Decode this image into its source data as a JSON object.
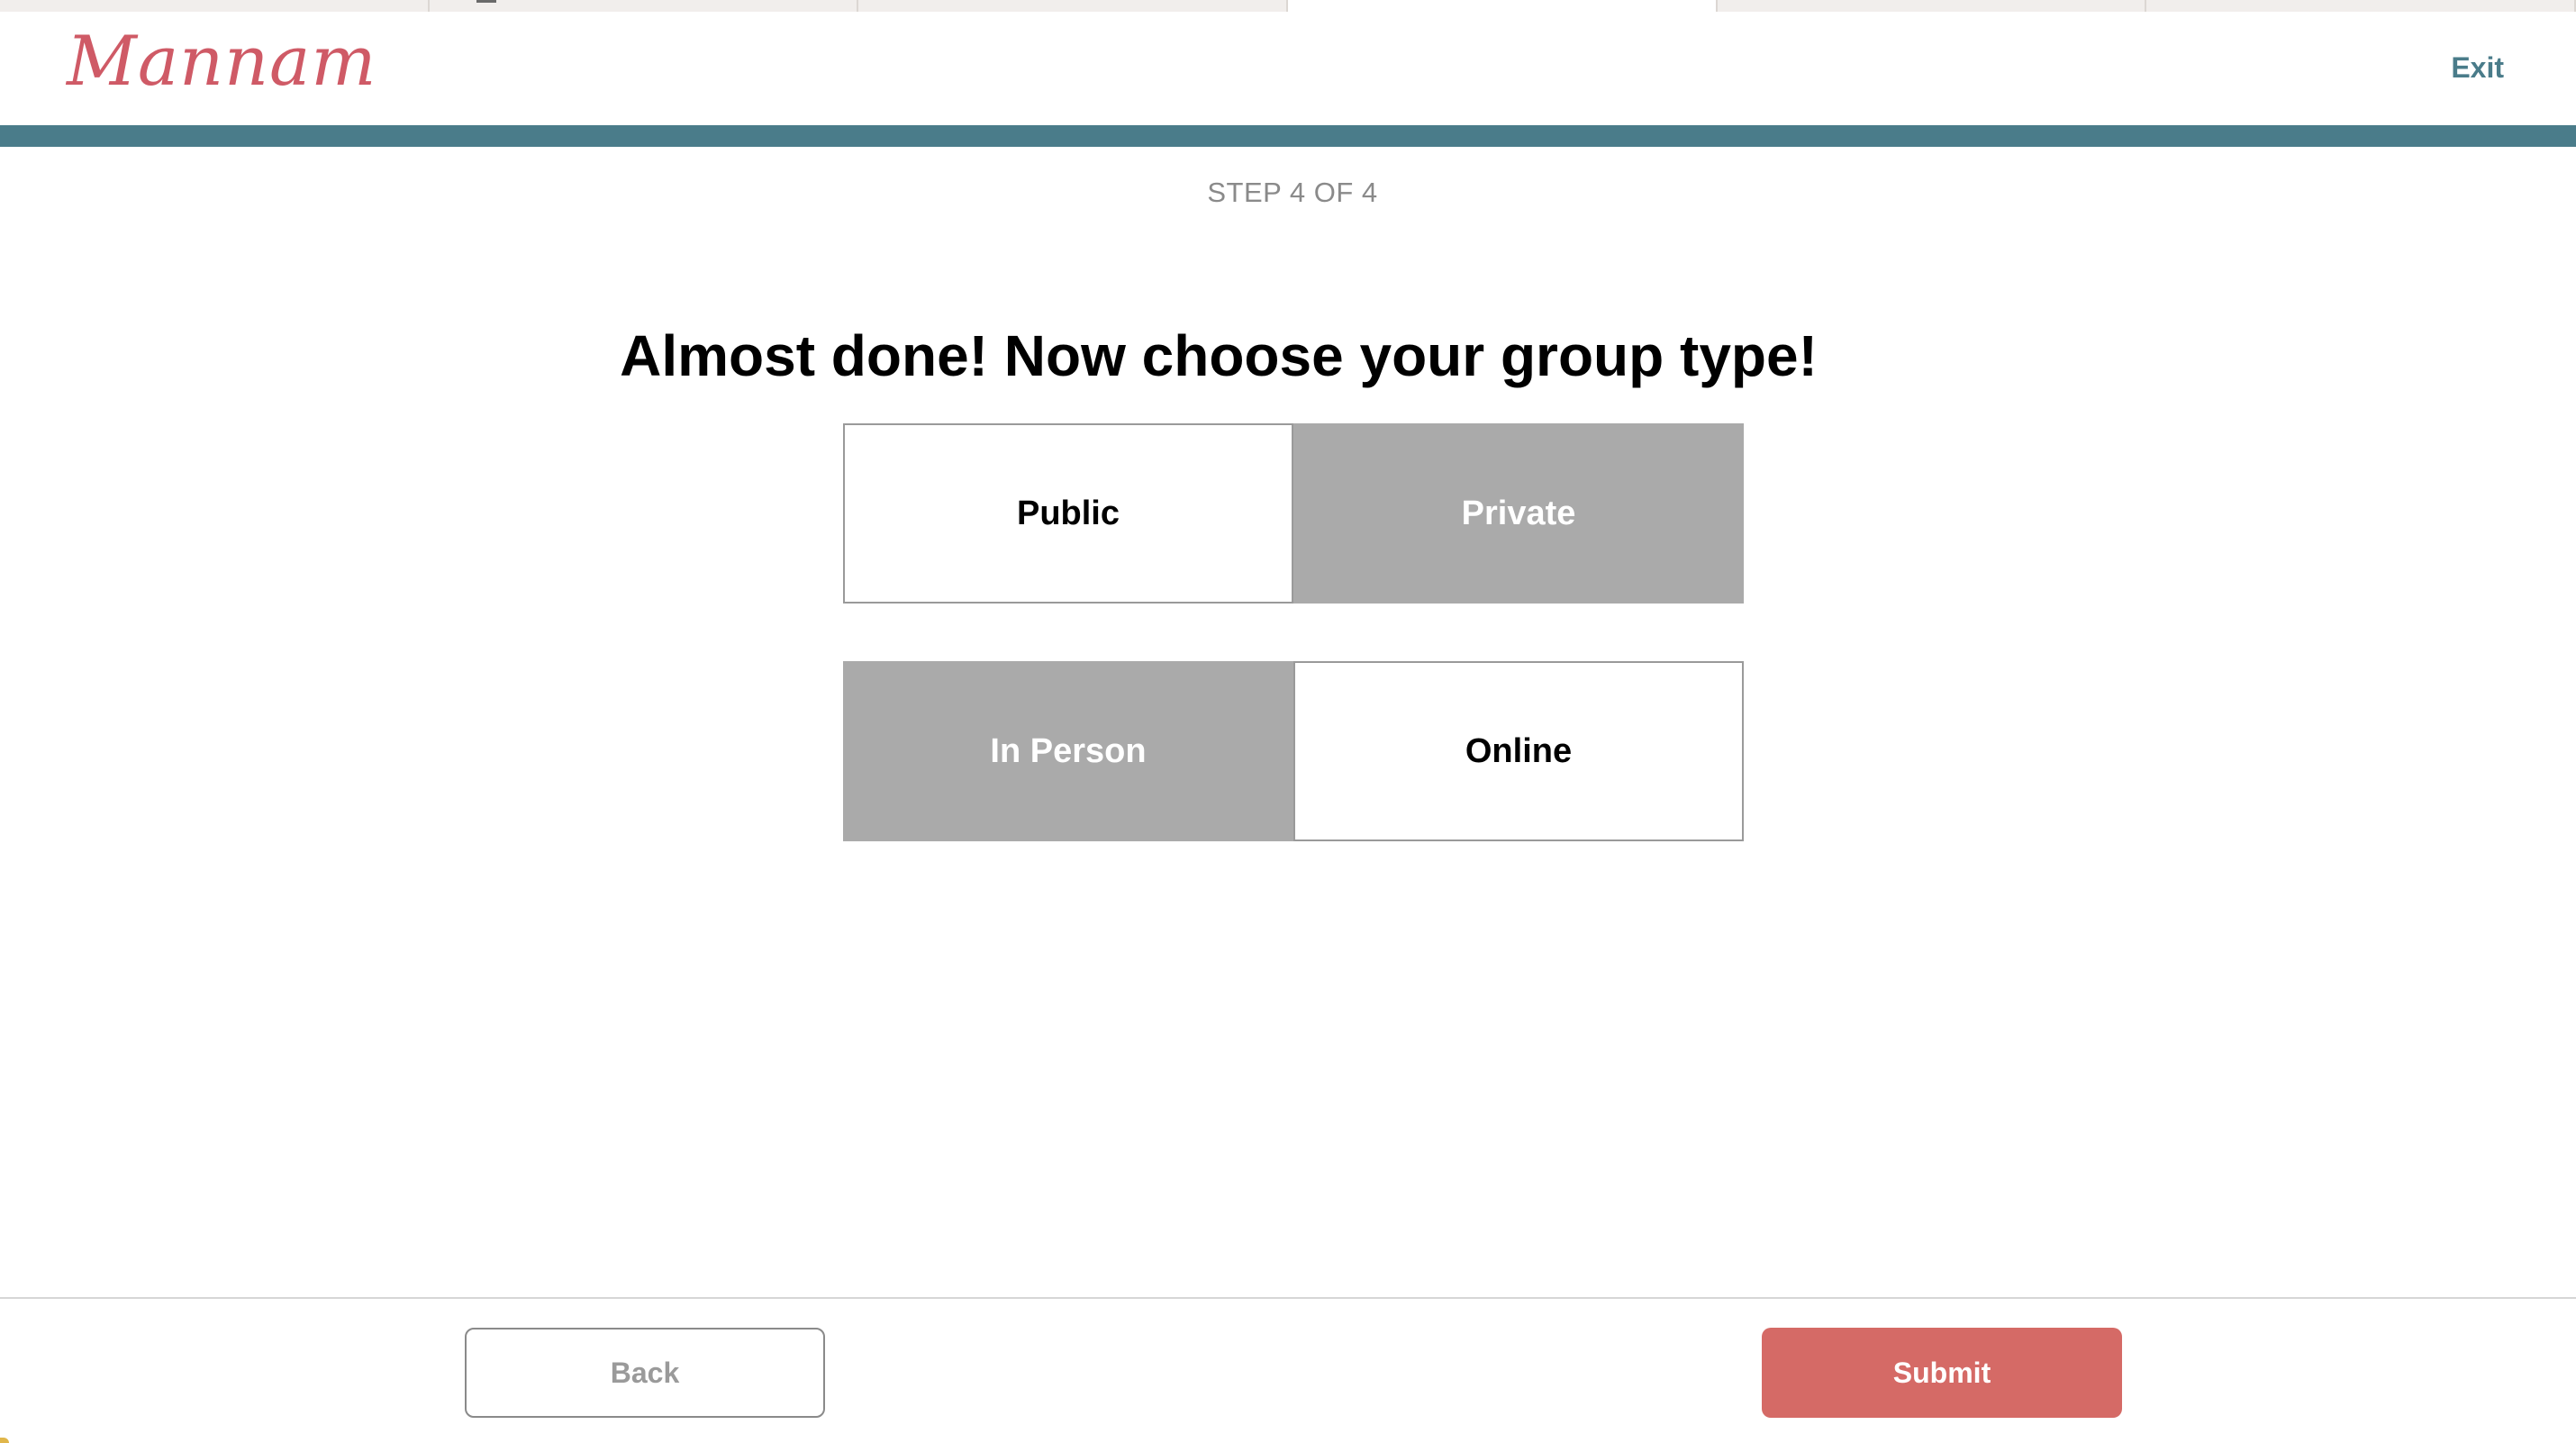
{
  "app": {
    "logo_text": "Mannam",
    "exit_label": "Exit",
    "brand_color": "#cf5a66",
    "accent_color": "#4a7c8a"
  },
  "progress": {
    "step_label": "STEP 4 OF 4",
    "fraction": 1.0
  },
  "main": {
    "title": "Almost done! Now choose your group type!",
    "visibility_options": [
      {
        "label": "Public",
        "selected": false
      },
      {
        "label": "Private",
        "selected": true
      }
    ],
    "format_options": [
      {
        "label": "In Person",
        "selected": true
      },
      {
        "label": "Online",
        "selected": false
      }
    ]
  },
  "footer": {
    "back_label": "Back",
    "submit_label": "Submit",
    "submit_color": "#d56a66"
  }
}
